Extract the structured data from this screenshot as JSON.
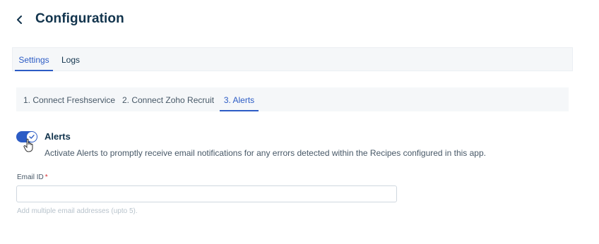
{
  "header": {
    "title": "Configuration",
    "back_icon": "chevron-left-icon"
  },
  "main_tabs": [
    {
      "label": "Settings",
      "active": true
    },
    {
      "label": "Logs",
      "active": false
    }
  ],
  "steps": [
    {
      "label": "1. Connect Freshservice",
      "active": false
    },
    {
      "label": "2. Connect Zoho Recruit",
      "active": false
    },
    {
      "label": "3. Alerts",
      "active": true
    }
  ],
  "alerts": {
    "enabled": true,
    "title": "Alerts",
    "description": "Activate Alerts to promptly receive email notifications for any errors detected within the Recipes configured in this app."
  },
  "email": {
    "label": "Email ID",
    "required_marker": "*",
    "value": "",
    "hint": "Add multiple email addresses (upto 5)."
  },
  "colors": {
    "accent": "#2c5cc5",
    "text": "#12344d",
    "required": "#d72d30"
  }
}
